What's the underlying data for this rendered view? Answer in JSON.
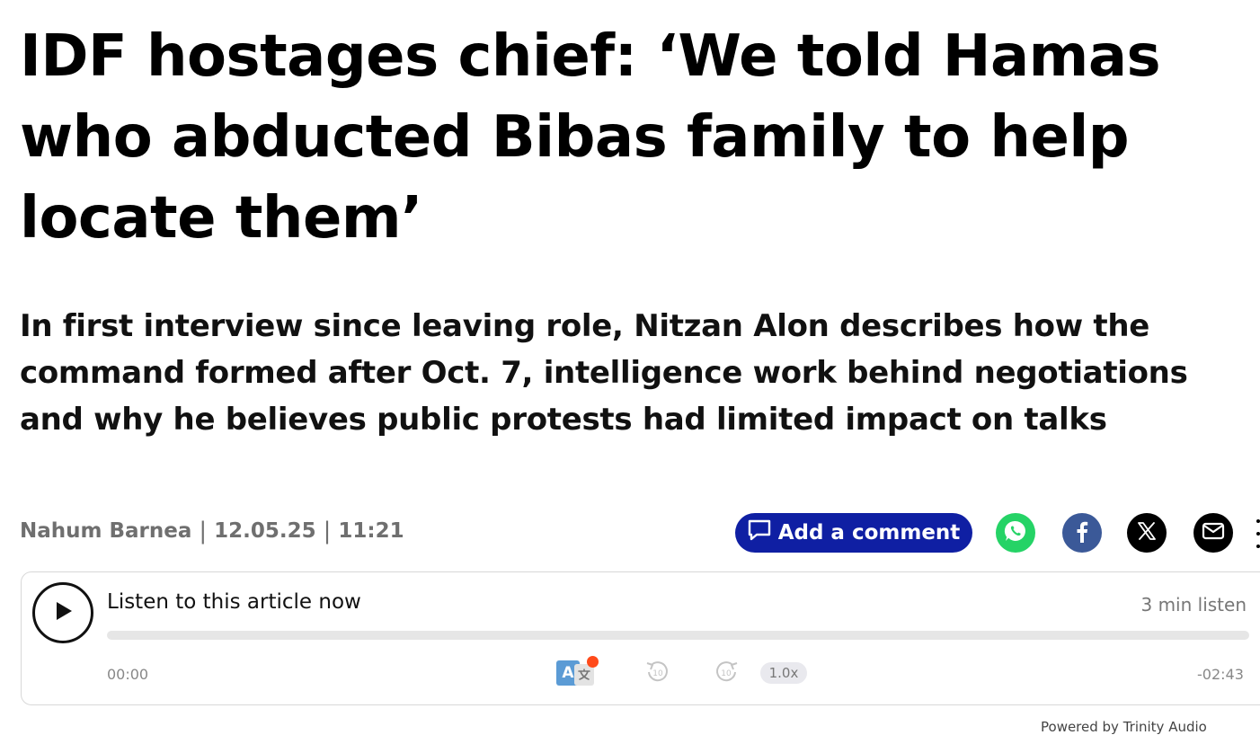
{
  "article": {
    "headline": "IDF hostages chief: ‘We told Hamas who abducted Bibas family to help locate them’",
    "subheadline": "In first interview since leaving role, Nitzan Alon describes how the command formed after Oct. 7, intelligence work behind negotiations and why he believes public protests had limited impact on talks",
    "author": "Nahum Barnea",
    "separator": "|",
    "date": "12.05.25",
    "time": "11:21"
  },
  "share": {
    "comment_label": "Add a comment",
    "icons": [
      "comment-icon",
      "whatsapp-icon",
      "facebook-icon",
      "x-icon",
      "email-icon",
      "more-icon"
    ],
    "colors": {
      "comment_button": "#0f1fa3",
      "whatsapp": "#25d366",
      "facebook": "#3b5998",
      "x": "#000000",
      "email": "#000000"
    }
  },
  "audio_player": {
    "title": "Listen to this article now",
    "duration": "3 min listen",
    "current_time": "00:00",
    "remaining_time": "-02:43",
    "speed": "1.0x",
    "progress": 0,
    "rewind_seconds": "10",
    "forward_seconds": "10",
    "translate_icon_text": "A",
    "powered_by": "Powered by Trinity Audio",
    "icons": [
      "play-icon",
      "translate-icon",
      "rewind-10-icon",
      "forward-10-icon"
    ]
  }
}
